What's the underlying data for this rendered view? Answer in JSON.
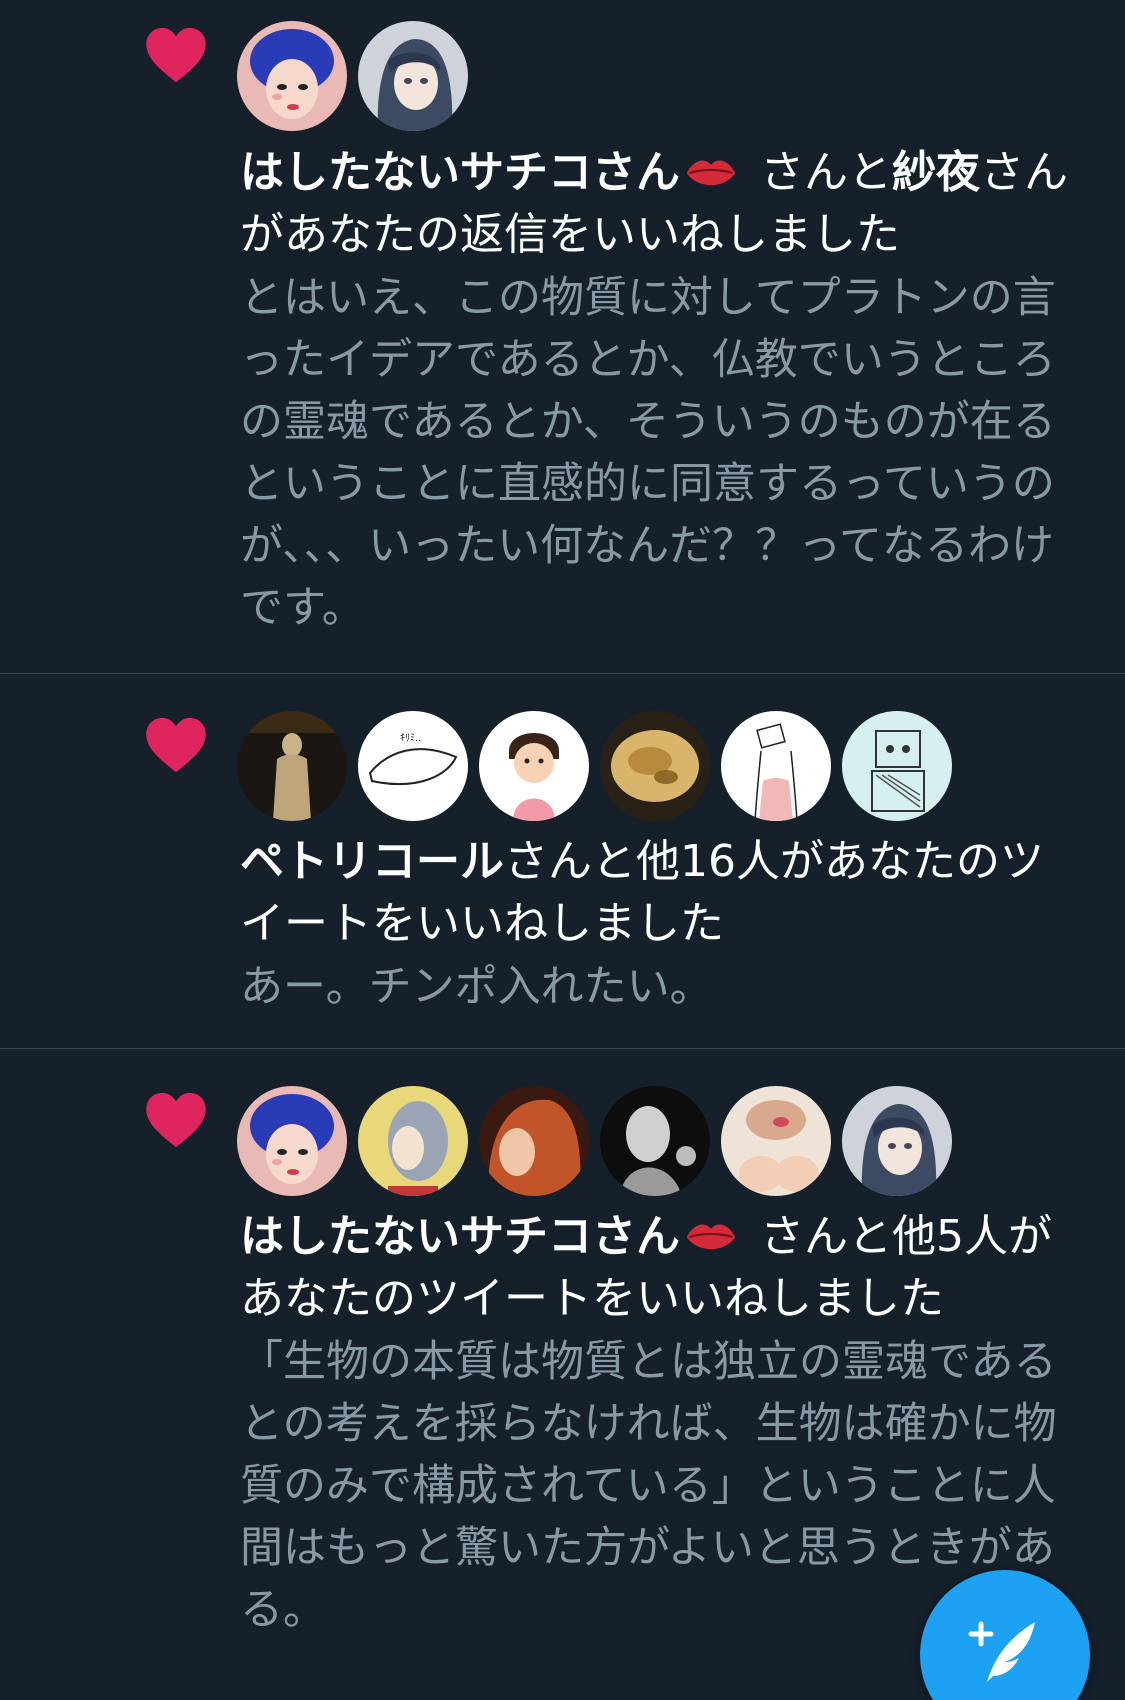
{
  "colors": {
    "background": "#15202b",
    "divider": "#38444d",
    "heart": "#e0245e",
    "headline_text": "#ffffff",
    "body_text": "#8899a6",
    "fab": "#1da1f2"
  },
  "notifications": [
    {
      "type": "like",
      "icon": "heart-icon",
      "actor_primary": "はしたないサチコさん",
      "actor_primary_emoji": "kiss-lips-icon",
      "connector": " さんと",
      "actor_secondary": "紗夜",
      "rest": "さんがあなたの返信をいいねしました",
      "tweet_text": "とはいえ、この物質に対してプラトンの言ったイデアであるとか、仏教でいうところの霊魂であるとか、そういうのものが在るということに直感的に同意するっていうのが、、、いったい何なんだ？？ってなるわけです。",
      "avatars": [
        "avatar-blue-hair-cartoon-woman",
        "avatar-anime-girl-dark-hair"
      ]
    },
    {
      "type": "like",
      "icon": "heart-icon",
      "actor_primary": "ペトリコール",
      "rest": "さんと他16人があなたのツイートをいいねしました",
      "tweet_text": "あー。チンポ入れたい。",
      "avatars": [
        "avatar-statue",
        "avatar-doodle-sketch",
        "avatar-cartoon-girl",
        "avatar-food-plate",
        "avatar-line-drawing-woman",
        "avatar-robot-sketch"
      ]
    },
    {
      "type": "like",
      "icon": "heart-icon",
      "actor_primary": "はしたないサチコさん",
      "actor_primary_emoji": "kiss-lips-icon",
      "rest": " さんと他5人があなたのツイートをいいねしました",
      "tweet_text": "「生物の本質は物質とは独立の霊魂であるとの考えを採らなければ、生物は確かに物質のみで構成されている」ということに人間はもっと驚いた方がよいと思うときがある。",
      "avatars": [
        "avatar-blue-hair-cartoon-woman",
        "avatar-blurred-face",
        "avatar-redhead-woman",
        "avatar-monochrome-photo",
        "avatar-portrait-photo",
        "avatar-anime-girl-dark-hair"
      ]
    }
  ],
  "fab": {
    "icon": "compose-tweet-icon",
    "label": "+"
  }
}
